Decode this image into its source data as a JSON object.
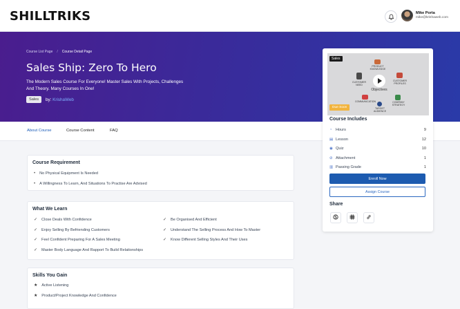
{
  "brand": {
    "logo_text": "SHILLTRIKS"
  },
  "user": {
    "name": "Mike Porta",
    "email": "mike@krishaweb.com"
  },
  "hero": {
    "breadcrumbs": [
      "Course List Page",
      "/",
      "Course Detail Page"
    ],
    "title": "Sales Ship: Zero To Hero",
    "description": "The Modern Sales Course For Everyone! Master Sales With Projects, Challenges And Theory. Many Courses In One!",
    "tag": "Sales",
    "by_label": "by:",
    "author": "KrishaWeb",
    "gradient_colors": [
      "#4a1d8e",
      "#2a3aa8"
    ]
  },
  "tabs": [
    {
      "label": "About Course",
      "active": true
    },
    {
      "label": "Course Content",
      "active": false
    },
    {
      "label": "FAQ",
      "active": false
    }
  ],
  "requirements": {
    "title": "Course Requirement",
    "items": [
      "No Physical Equipment Is Needed",
      "A Willingness To Learn, And Situations To Practise Are Advised"
    ]
  },
  "learn": {
    "title": "What We Learn",
    "left": [
      "Close Deals With Confidence",
      "Enjoy Selling By Befriending Customers",
      "Feel Confident Preparing For A Sales Meeting",
      "Master Body Language And Rapport To Build Relationships"
    ],
    "right": [
      "Be Organised And Efficient",
      "Understand The Selling Process And How To Master",
      "Know Different Selling Styles And Their Uses"
    ]
  },
  "skills": {
    "title": "Skills You Gain",
    "items": [
      "Active Listening",
      "Product/Project Knowledge And Confidence"
    ]
  },
  "sidebar": {
    "preview_badge": "Sales",
    "due_badge": "Due Soon",
    "preview_center": "Objectives",
    "preview_labels": [
      "PRODUCT KNOWLEDGE",
      "CUSTOMER NEED",
      "CUSTOMER PROFILES",
      "COMMUNICATION",
      "COMPANY STRATEGY",
      "TARGET AUDIENCE"
    ],
    "includes_title": "Course Includes",
    "includes": [
      {
        "icon": "clock-icon",
        "label": "Hours",
        "value": "9"
      },
      {
        "icon": "lesson-icon",
        "label": "Lesson",
        "value": "12"
      },
      {
        "icon": "quiz-icon",
        "label": "Quiz",
        "value": "10"
      },
      {
        "icon": "attachment-icon",
        "label": "Attachment",
        "value": "1"
      },
      {
        "icon": "grade-icon",
        "label": "Passing Grade",
        "value": "1"
      }
    ],
    "enroll_label": "Enroll Now",
    "assign_label": "Assign Course",
    "share_title": "Share"
  }
}
